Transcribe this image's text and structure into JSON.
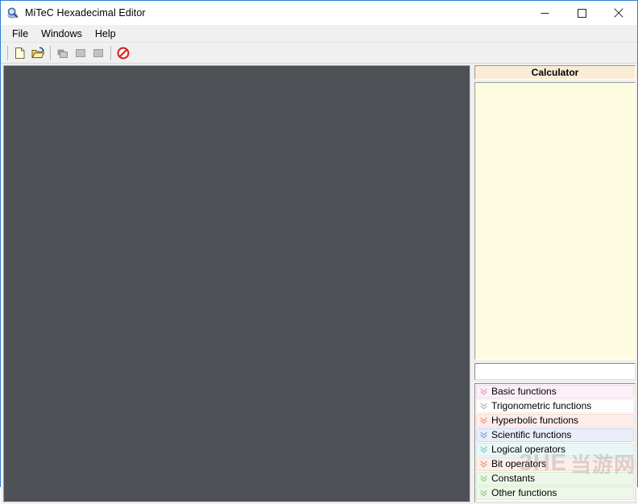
{
  "window": {
    "title": "MiTeC Hexadecimal Editor",
    "icon": "magnifier-disc-icon",
    "controls": {
      "minimize": "minimize-button",
      "maximize": "maximize-button",
      "close": "close-button"
    },
    "accent": "#2f7fd0"
  },
  "menubar": {
    "items": [
      {
        "label": "File"
      },
      {
        "label": "Windows"
      },
      {
        "label": "Help"
      }
    ]
  },
  "toolbar": {
    "buttons": [
      {
        "icon": "new-file-icon",
        "enabled": true
      },
      {
        "icon": "open-folder-icon",
        "enabled": true
      },
      {
        "icon": "copy-icon",
        "enabled": false
      },
      {
        "icon": "cut-icon",
        "enabled": false
      },
      {
        "icon": "paste-icon",
        "enabled": false
      },
      {
        "icon": "cancel-icon",
        "enabled": true
      }
    ]
  },
  "workspace": {
    "background": "#4e5257",
    "content": ""
  },
  "calculator": {
    "header": "Calculator",
    "display_value": "",
    "input_value": "",
    "input_placeholder": "",
    "groups": [
      {
        "label": "Basic functions",
        "tint": "#fdf0f8",
        "border": "#f2d8ea",
        "chevron": "#e49ccd"
      },
      {
        "label": "Trigonometric functions",
        "tint": "#ffffff",
        "border": "#ededed",
        "chevron": "#b9b9b9"
      },
      {
        "label": "Hyperbolic functions",
        "tint": "#fdeeea",
        "border": "#f6d7cf",
        "chevron": "#ec9a84"
      },
      {
        "label": "Scientific functions",
        "tint": "#eaeefb",
        "border": "#ccd5f0",
        "chevron": "#8fa3e0"
      },
      {
        "label": "Logical operators",
        "tint": "#e9f8f6",
        "border": "#c9ece7",
        "chevron": "#7fcec3"
      },
      {
        "label": "Bit operators",
        "tint": "#fdeeea",
        "border": "#f6d7cf",
        "chevron": "#ec9a84"
      },
      {
        "label": "Constants",
        "tint": "#eef8ea",
        "border": "#d4ecca",
        "chevron": "#96cf84"
      },
      {
        "label": "Other functions",
        "tint": "#eef8ea",
        "border": "#d4ecca",
        "chevron": "#96cf84"
      }
    ]
  },
  "watermark": {
    "latin": "3HE",
    "cjk": "当游网"
  }
}
